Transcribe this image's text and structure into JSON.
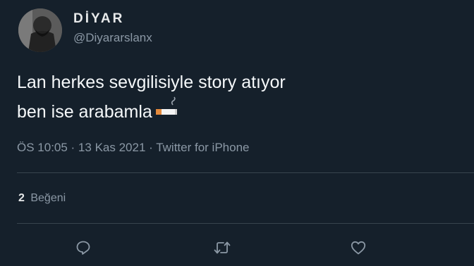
{
  "author": {
    "display_name": "DİYAR",
    "handle": "@Diyararslanx",
    "avatar_icon": "profile-photo"
  },
  "tweet": {
    "text_lines": [
      "Lan herkes sevgilisiyle story atıyor",
      "ben ise arabamla"
    ],
    "emoji_icon": "cigarette-icon",
    "timestamp": "ÖS 10:05 · 13 Kas 2021 · Twitter for iPhone"
  },
  "stats": {
    "likes_count": "2",
    "likes_label": "Beğeni"
  },
  "actions": {
    "reply_icon": "reply-icon",
    "retweet_icon": "retweet-icon",
    "like_icon": "heart-icon"
  },
  "colors": {
    "background": "#15202b",
    "text": "#e7e9ea",
    "secondary_text": "#8b98a5",
    "divider": "#38444d"
  }
}
